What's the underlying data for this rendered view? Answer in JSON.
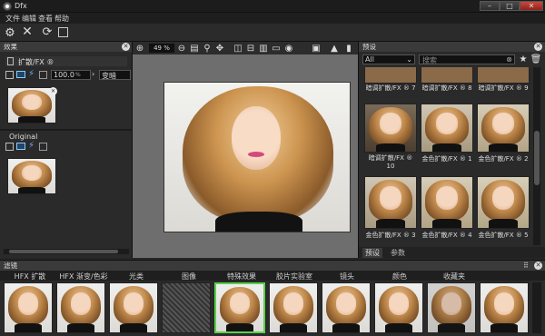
{
  "app": {
    "title": "Dfx",
    "accent": "#5ad04a"
  },
  "menu": [
    "文件",
    "编辑",
    "查看",
    "帮助"
  ],
  "effects_panel": {
    "title": "效果",
    "item_label": "扩散/FX ®",
    "value": "100.0",
    "unit": "%",
    "blend_mode": "变暗",
    "original_label": "Original"
  },
  "viewer": {
    "zoom": "49 %"
  },
  "presets_panel": {
    "title": "预设",
    "filter_value": "All",
    "search_placeholder": "搜索",
    "rows": [
      [
        "暗调扩散/FX ® 7",
        "暗调扩散/FX ® 8",
        "暗调扩散/FX ® 9"
      ],
      [
        "暗调扩散/FX ® 10",
        "金色扩散/FX ® 1",
        "金色扩散/FX ® 2"
      ],
      [
        "金色扩散/FX ® 3",
        "金色扩散/FX ® 4",
        "金色扩散/FX ® 5"
      ]
    ],
    "tabs": [
      "预设",
      "参数"
    ]
  },
  "filters_bar": {
    "title": "滤镜",
    "categories": [
      "HFX 扩散",
      "HFX 渐变/色彩",
      "光类",
      "图像",
      "特殊效果",
      "胶片实验室",
      "镜头",
      "颜色",
      "收藏夹"
    ]
  }
}
